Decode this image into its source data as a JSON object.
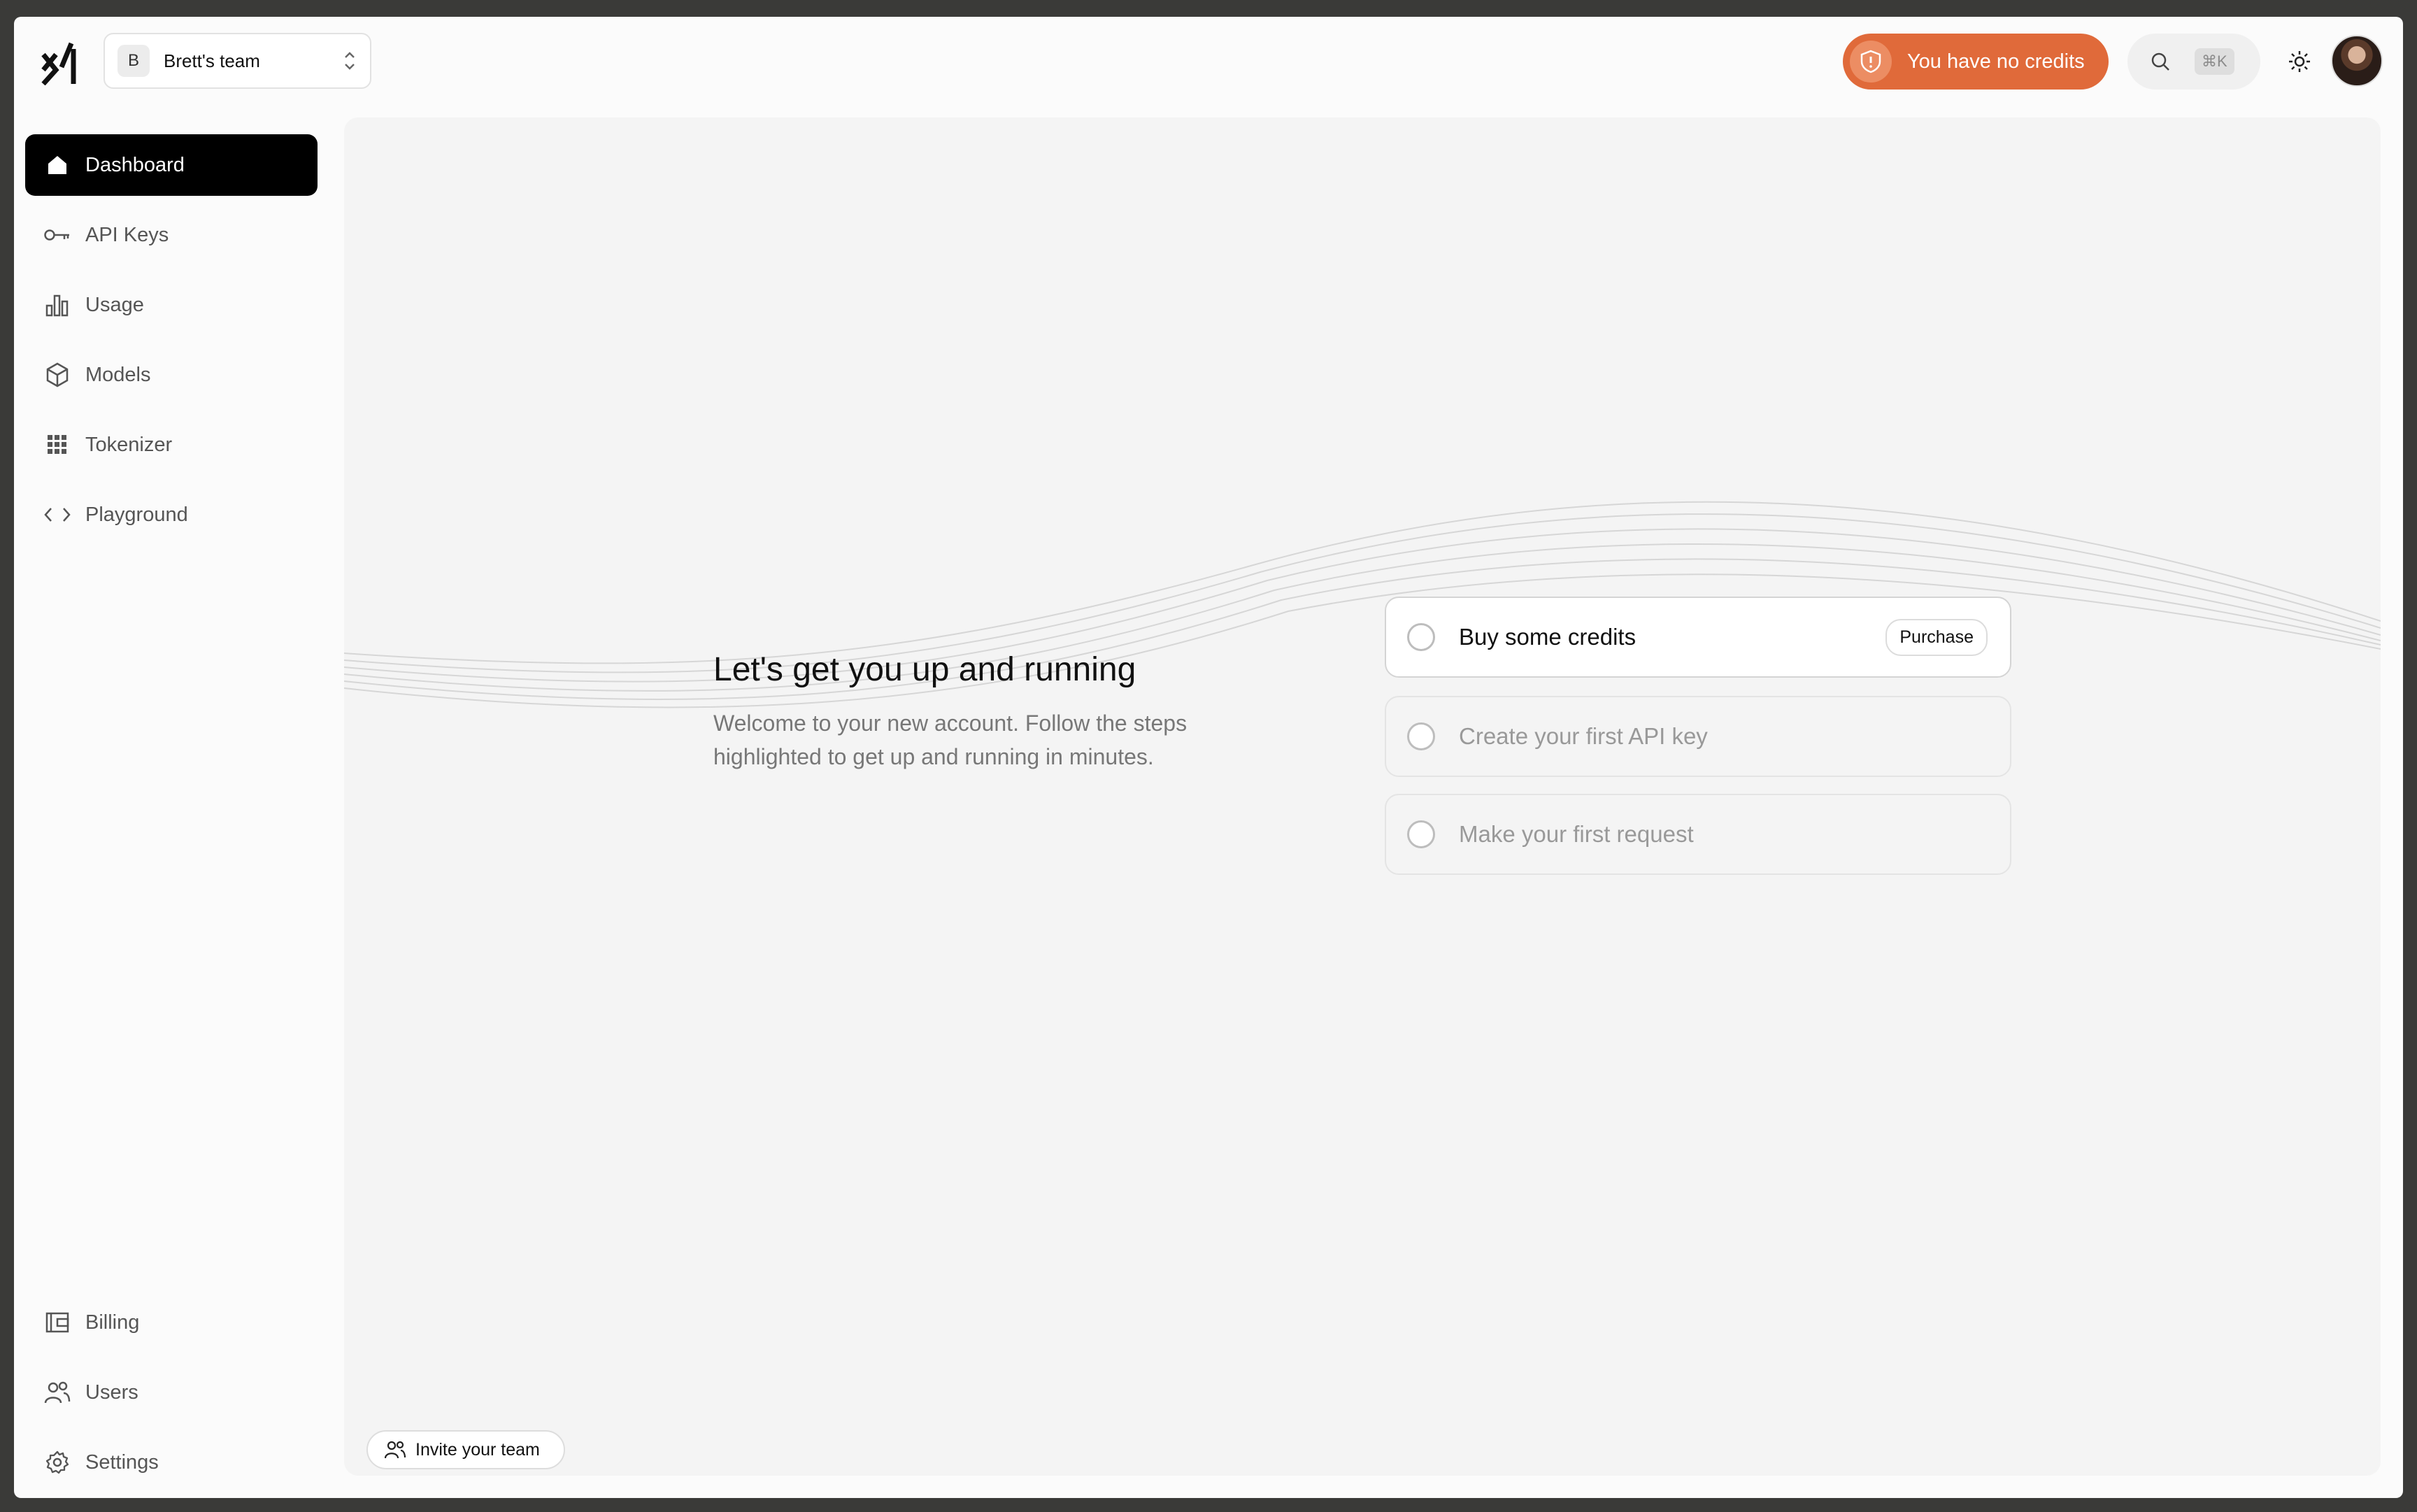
{
  "header": {
    "logo_name": "xAI",
    "team": {
      "initial": "B",
      "name": "Brett's team"
    },
    "credits_alert": "You have no credits",
    "search": {
      "shortcut": "⌘K"
    }
  },
  "sidebar": {
    "items": [
      {
        "label": "Dashboard",
        "icon": "home-icon",
        "active": true
      },
      {
        "label": "API Keys",
        "icon": "key-icon"
      },
      {
        "label": "Usage",
        "icon": "bar-chart-icon"
      },
      {
        "label": "Models",
        "icon": "cube-icon"
      },
      {
        "label": "Tokenizer",
        "icon": "grid-icon"
      },
      {
        "label": "Playground",
        "icon": "code-icon"
      }
    ],
    "bottom_items": [
      {
        "label": "Billing",
        "icon": "wallet-icon"
      },
      {
        "label": "Users",
        "icon": "users-icon"
      },
      {
        "label": "Settings",
        "icon": "gear-icon"
      }
    ]
  },
  "main": {
    "title": "Let's get you up and running",
    "subtitle": "Welcome to your new account. Follow the steps highlighted to get up and running in minutes.",
    "steps": [
      {
        "label": "Buy some credits",
        "action": "Purchase"
      },
      {
        "label": "Create your first API key"
      },
      {
        "label": "Make your first request"
      }
    ],
    "invite_label": "Invite your team"
  },
  "colors": {
    "accent": "#e06a3a",
    "active_nav": "#000000",
    "panel": "#f4f4f4"
  }
}
